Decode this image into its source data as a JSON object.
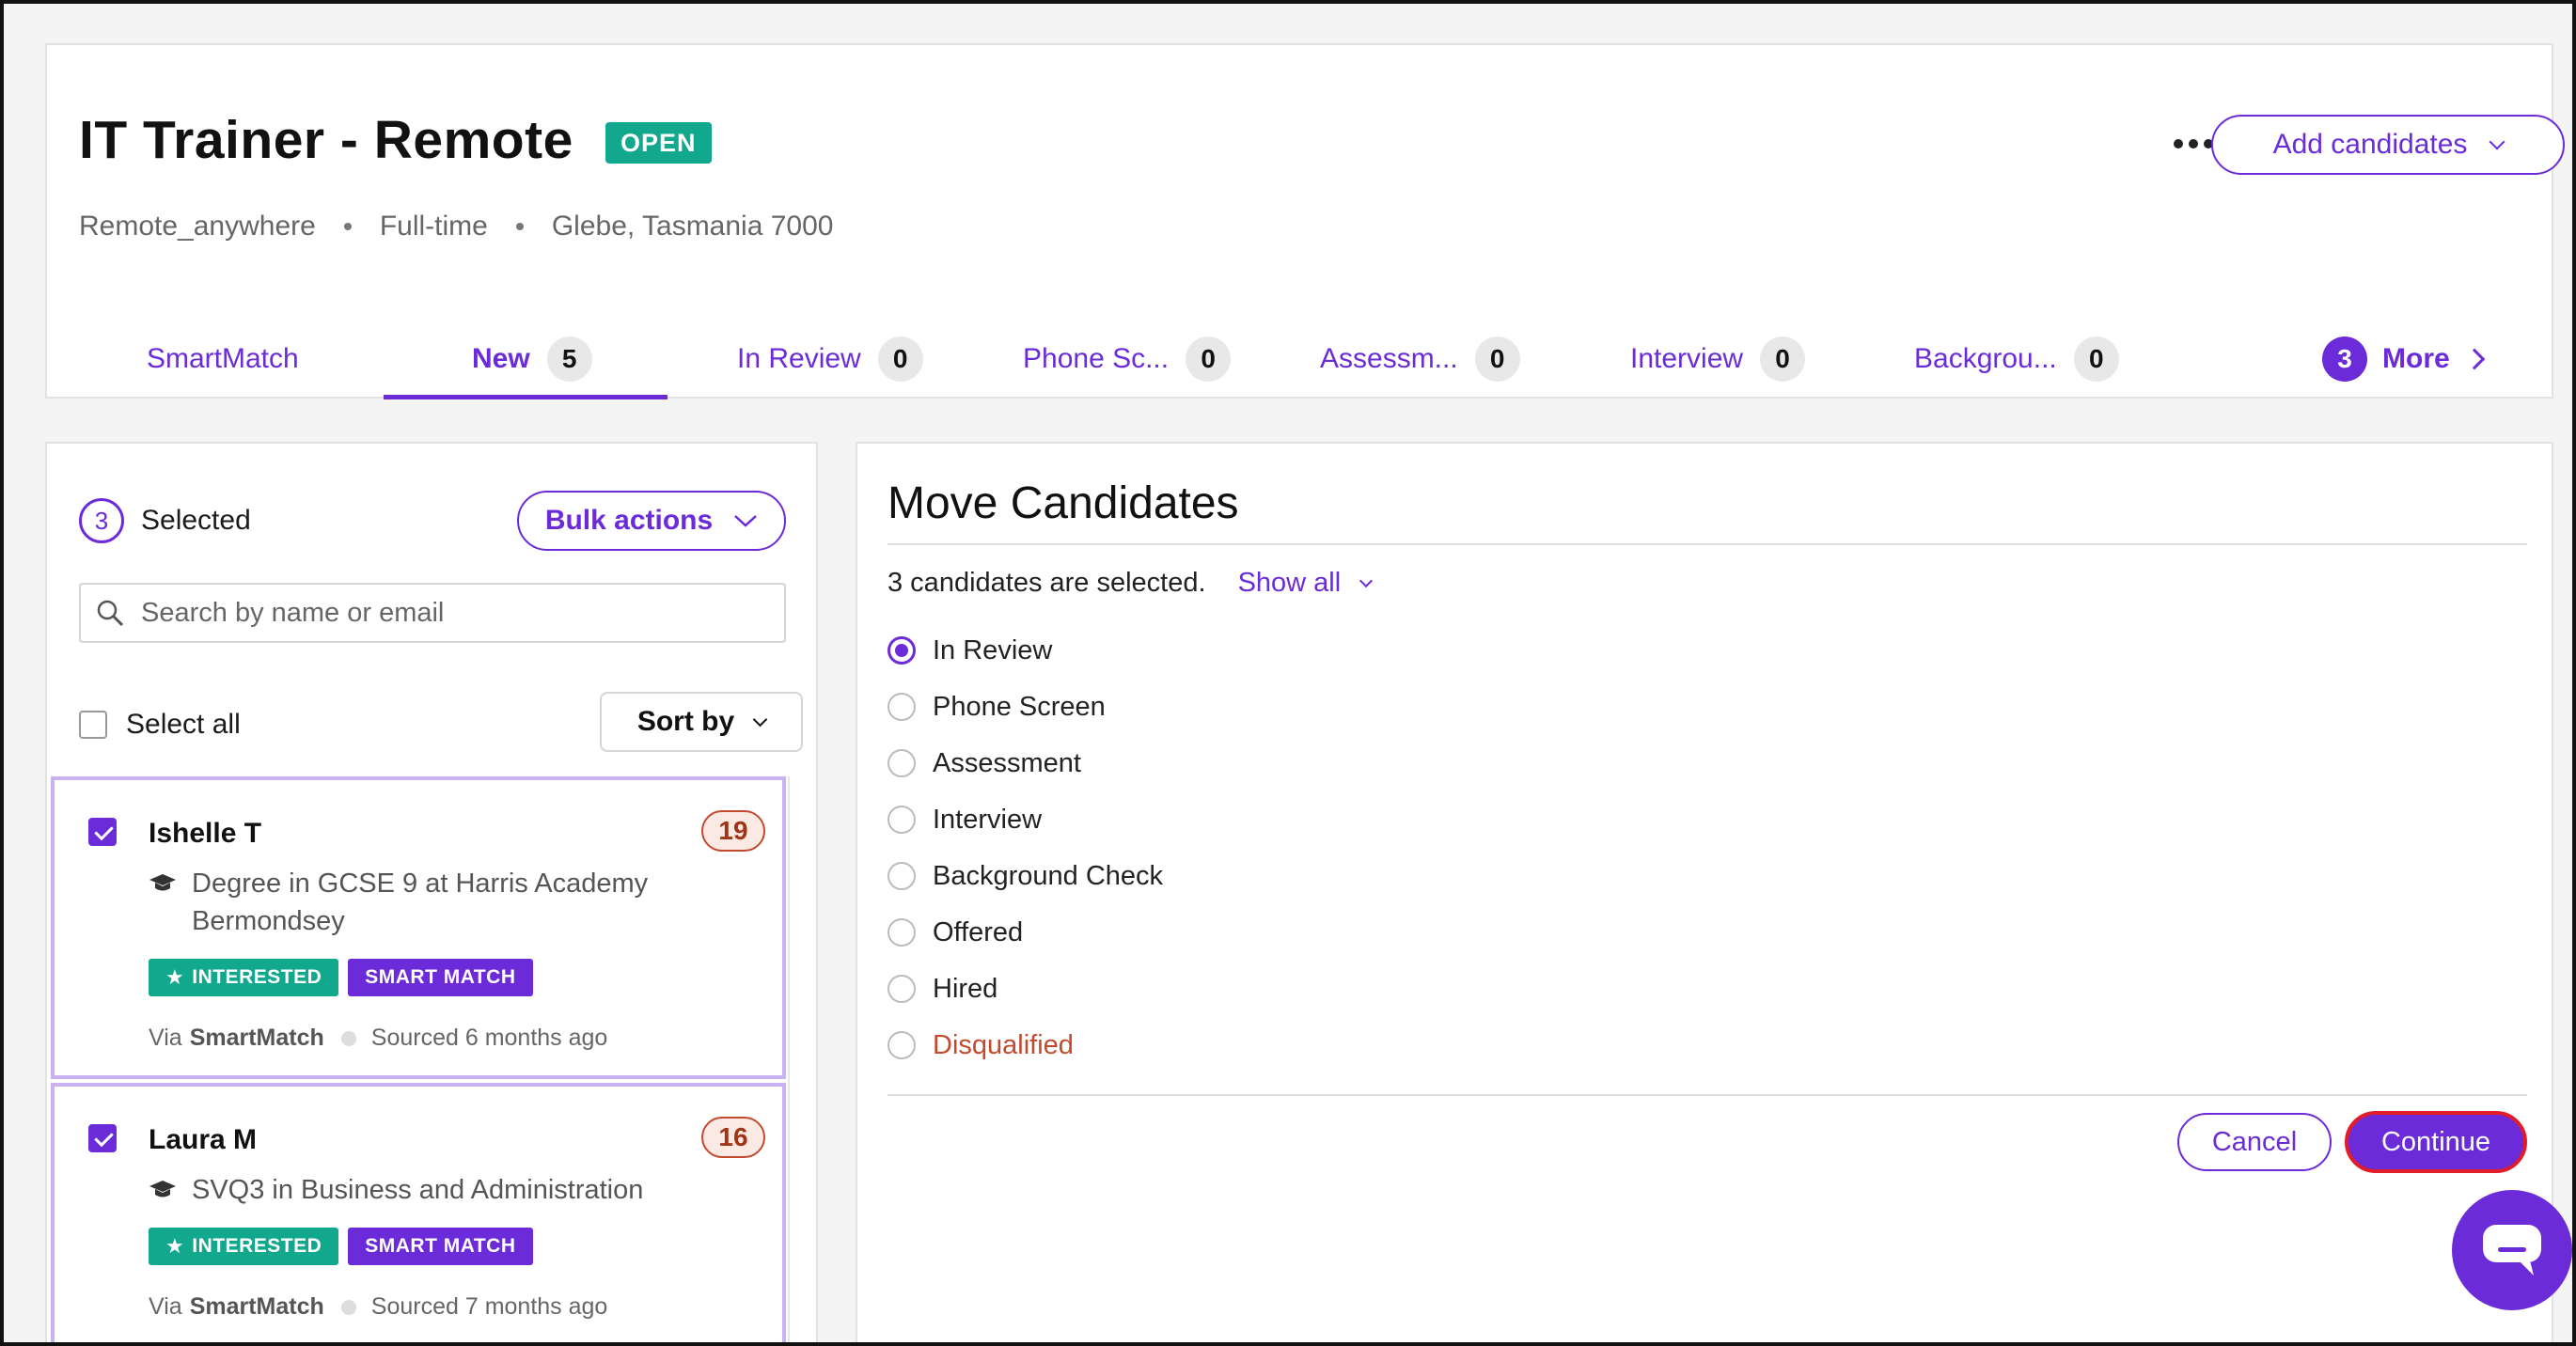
{
  "job": {
    "title": "IT Trainer - Remote",
    "status": "OPEN",
    "meta": [
      "Remote_anywhere",
      "Full-time",
      "Glebe, Tasmania 7000"
    ],
    "add_candidates_label": "Add candidates"
  },
  "tabs": [
    {
      "label": "SmartMatch",
      "count": null
    },
    {
      "label": "New",
      "count": "5"
    },
    {
      "label": "In Review",
      "count": "0"
    },
    {
      "label": "Phone Sc...",
      "count": "0"
    },
    {
      "label": "Assessm...",
      "count": "0"
    },
    {
      "label": "Interview",
      "count": "0"
    },
    {
      "label": "Backgrou...",
      "count": "0"
    }
  ],
  "more_tab": {
    "count": "3",
    "label": "More"
  },
  "left": {
    "selected_count": "3",
    "selected_label": "Selected",
    "bulk_actions_label": "Bulk actions",
    "search_placeholder": "Search by name or email",
    "select_all_label": "Select all",
    "sort_label": "Sort by"
  },
  "candidates": [
    {
      "name": "Ishelle T",
      "score": "19",
      "education": "Degree in GCSE 9 at Harris Academy Bermondsey",
      "tags": [
        "INTERESTED",
        "SMART MATCH"
      ],
      "via_prefix": "Via",
      "via_source": "SmartMatch",
      "sourced": "Sourced 6 months ago"
    },
    {
      "name": "Laura M",
      "score": "16",
      "education": "SVQ3 in Business and Administration",
      "tags": [
        "INTERESTED",
        "SMART MATCH"
      ],
      "via_prefix": "Via",
      "via_source": "SmartMatch",
      "sourced": "Sourced 7 months ago"
    }
  ],
  "move": {
    "title": "Move Candidates",
    "selected_info": "3 candidates are selected.",
    "show_all_label": "Show all",
    "stages": [
      "In Review",
      "Phone Screen",
      "Assessment",
      "Interview",
      "Background Check",
      "Offered",
      "Hired",
      "Disqualified"
    ],
    "cancel_label": "Cancel",
    "continue_label": "Continue"
  },
  "colors": {
    "accent": "#6b2bd9",
    "success": "#12a88e",
    "danger": "#c24a2e"
  }
}
